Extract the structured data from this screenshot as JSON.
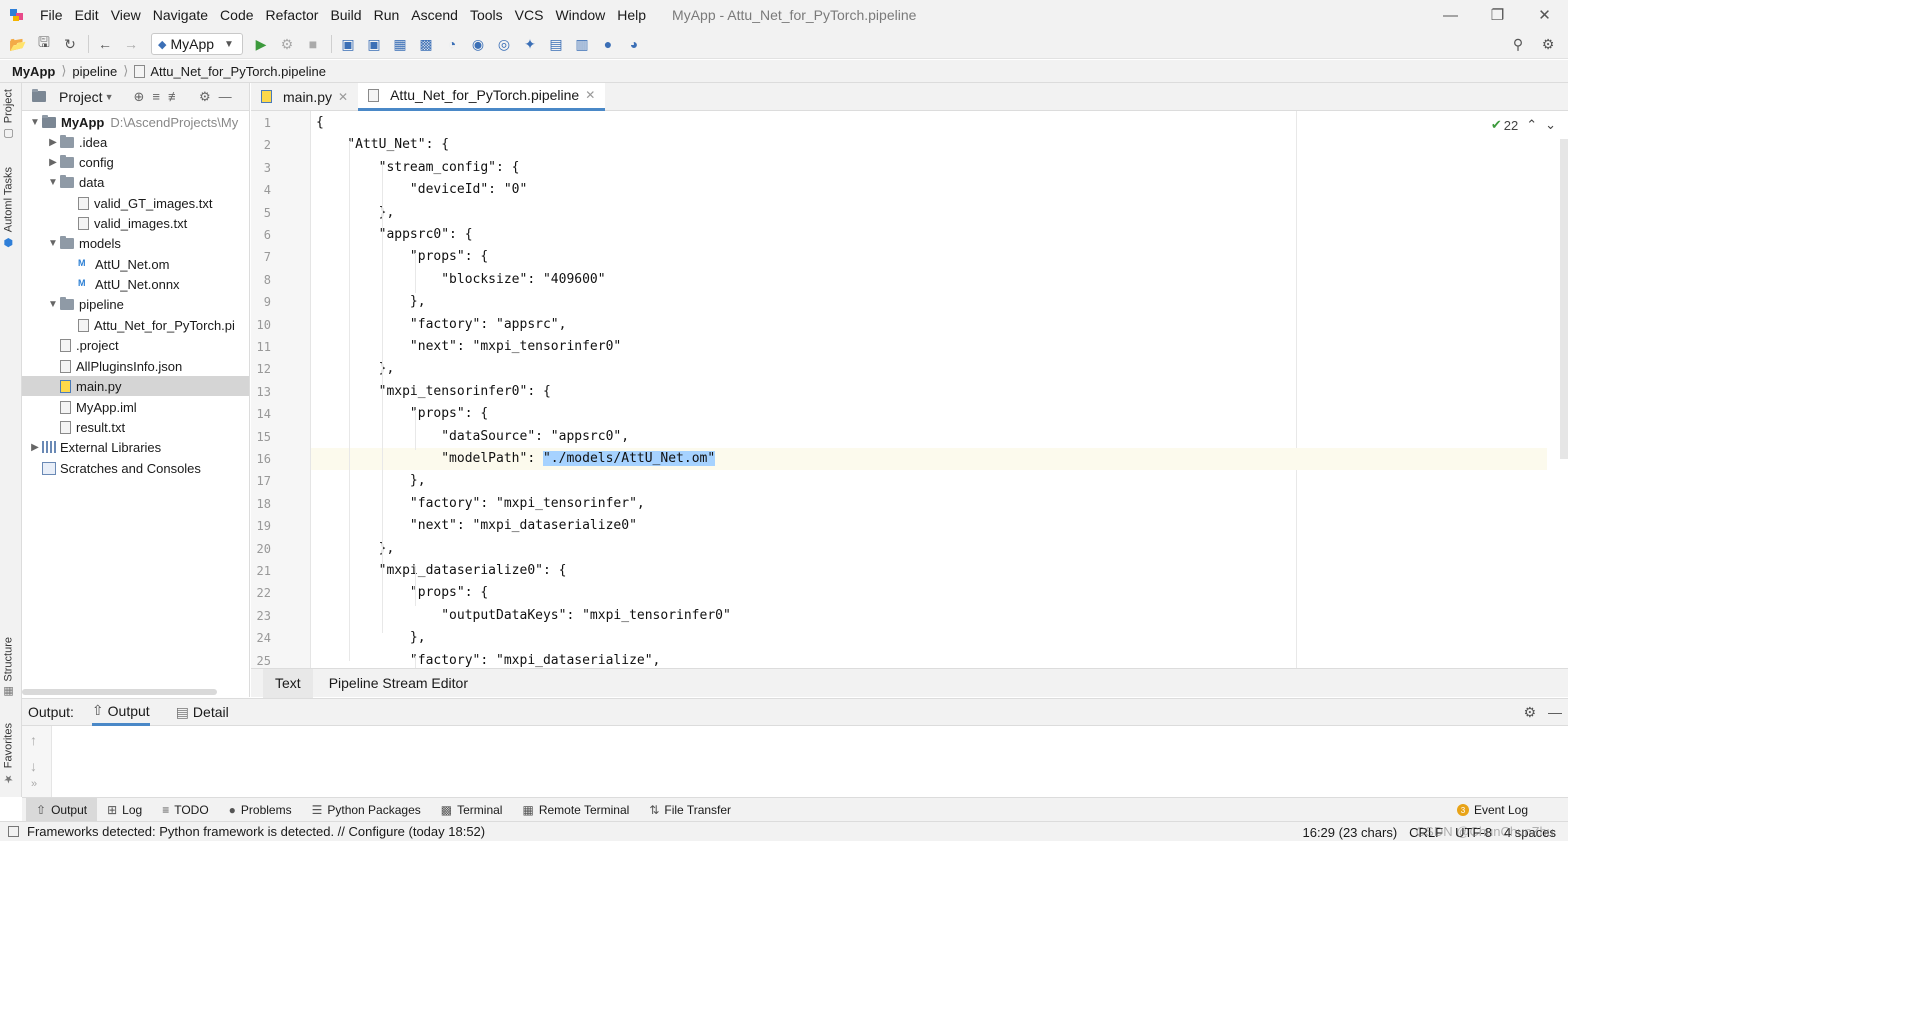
{
  "menubar": {
    "items": [
      "File",
      "Edit",
      "View",
      "Navigate",
      "Code",
      "Refactor",
      "Build",
      "Run",
      "Ascend",
      "Tools",
      "VCS",
      "Window",
      "Help"
    ],
    "title": "MyApp - Attu_Net_for_PyTorch.pipeline"
  },
  "toolbar": {
    "run_config": "MyApp"
  },
  "breadcrumb": [
    "MyApp",
    "pipeline",
    "Attu_Net_for_PyTorch.pipeline"
  ],
  "left_stripe": [
    "Project",
    "Automl Tasks",
    "Structure",
    "Favorites"
  ],
  "project": {
    "title": "Project",
    "root_name": "MyApp",
    "root_path": "D:\\AscendProjects\\My",
    "items": [
      {
        "label": ".idea"
      },
      {
        "label": "config"
      },
      {
        "label": "data"
      },
      {
        "label": "valid_GT_images.txt"
      },
      {
        "label": "valid_images.txt"
      },
      {
        "label": "models"
      },
      {
        "label": "AttU_Net.om"
      },
      {
        "label": "AttU_Net.onnx"
      },
      {
        "label": "pipeline"
      },
      {
        "label": "Attu_Net_for_PyTorch.pi"
      },
      {
        "label": ".project"
      },
      {
        "label": "AllPluginsInfo.json"
      },
      {
        "label": "main.py"
      },
      {
        "label": "MyApp.iml"
      },
      {
        "label": "result.txt"
      },
      {
        "label": "External Libraries"
      },
      {
        "label": "Scratches and Consoles"
      }
    ]
  },
  "tabs": [
    "main.py",
    "Attu_Net_for_PyTorch.pipeline"
  ],
  "editor": {
    "inspection_count": "22",
    "line_numbers": [
      "1",
      "2",
      "3",
      "4",
      "5",
      "6",
      "7",
      "8",
      "9",
      "10",
      "11",
      "12",
      "13",
      "14",
      "15",
      "16",
      "17",
      "18",
      "19",
      "20",
      "21",
      "22",
      "23",
      "24",
      "25"
    ],
    "lines": [
      "{",
      "    \"AttU_Net\": {",
      "        \"stream_config\": {",
      "            \"deviceId\": \"0\"",
      "        },",
      "        \"appsrc0\": {",
      "            \"props\": {",
      "                \"blocksize\": \"409600\"",
      "            },",
      "            \"factory\": \"appsrc\",",
      "            \"next\": \"mxpi_tensorinfer0\"",
      "        },",
      "        \"mxpi_tensorinfer0\": {",
      "            \"props\": {",
      "                \"dataSource\": \"appsrc0\",",
      "                \"modelPath\": ",
      "            },",
      "            \"factory\": \"mxpi_tensorinfer\",",
      "            \"next\": \"mxpi_dataserialize0\"",
      "        },",
      "        \"mxpi_dataserialize0\": {",
      "            \"props\": {",
      "                \"outputDataKeys\": \"mxpi_tensorinfer0\"",
      "            },",
      "            \"factory\": \"mxpi_dataserialize\","
    ],
    "selected_text": "\"./models/AttU_Net.om\"",
    "bottom_tabs": [
      "Text",
      "Pipeline Stream Editor"
    ]
  },
  "output": {
    "label": "Output:",
    "tabs": [
      "Output",
      "Detail"
    ]
  },
  "toolwindows": [
    "Output",
    "Log",
    "TODO",
    "Problems",
    "Python Packages",
    "Terminal",
    "Remote Terminal",
    "File Transfer"
  ],
  "event_log": {
    "label": "Event Log",
    "count": "3"
  },
  "status": {
    "message": "Frameworks detected: Python framework is detected. // Configure (today 18:52)",
    "position": "16:29 (23 chars)",
    "line_sep": "CRLF",
    "encoding": "UTF-8",
    "indent": "4 spaces",
    "watermark": "CSDN @ChunChunZhu"
  }
}
